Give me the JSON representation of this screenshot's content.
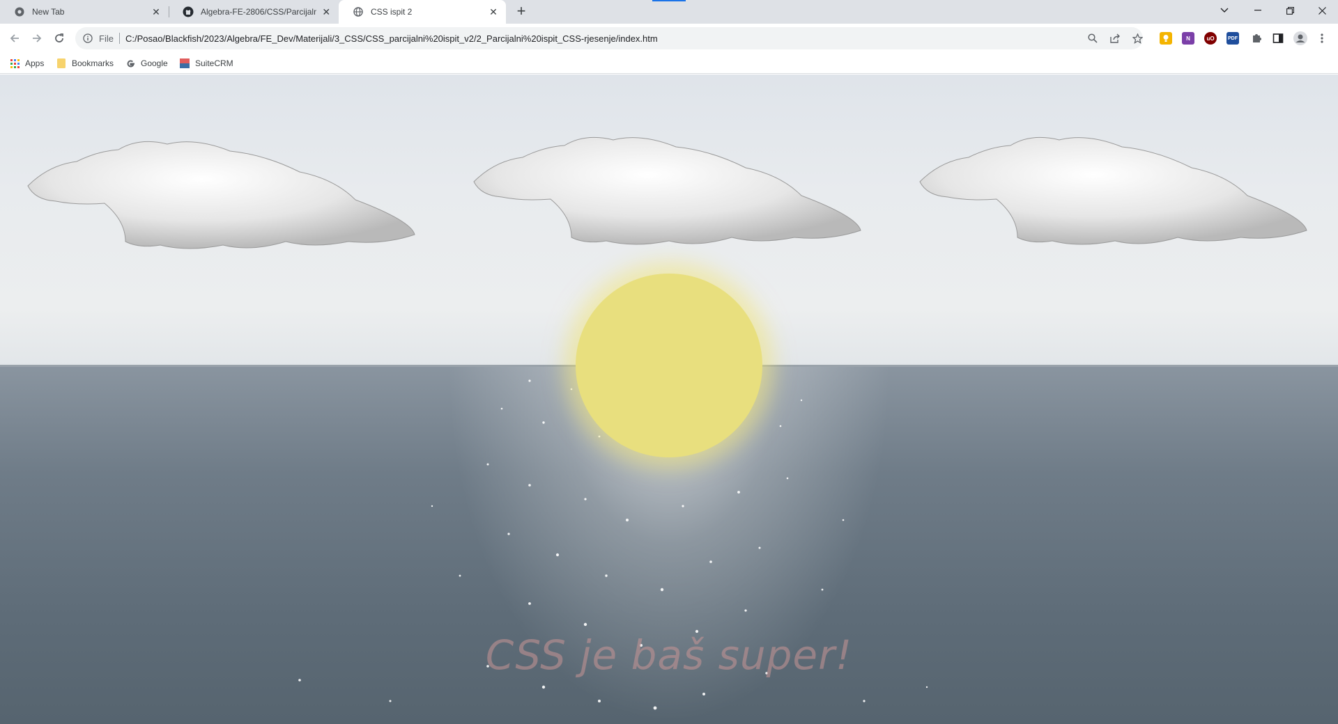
{
  "browser": {
    "tabs": [
      {
        "title": "New Tab",
        "icon": "chrome-icon",
        "active": false
      },
      {
        "title": "Algebra-FE-2806/CSS/Parcijalni",
        "icon": "github-icon",
        "active": false
      },
      {
        "title": "CSS ispit 2",
        "icon": "globe-icon",
        "active": true
      }
    ],
    "new_tab_symbol": "+",
    "close_symbol": "✕",
    "omnibox": {
      "scheme_label": "File",
      "url": "C:/Posao/Blackfish/2023/Algebra/FE_Dev/Materijali/3_CSS/CSS_parcijalni%20ispit_v2/2_Parcijalni%20ispit_CSS-rjesenje/index.htm"
    },
    "extensions": [
      {
        "name": "keep-icon",
        "color": "#f4b400",
        "label": ""
      },
      {
        "name": "onenote-icon",
        "color": "#7b3fa8",
        "label": "N"
      },
      {
        "name": "ublock-icon",
        "color": "#800000",
        "label": "uO"
      },
      {
        "name": "pdf-icon",
        "color": "#1f4e9c",
        "label": "PDF"
      }
    ],
    "bookmarks": [
      {
        "label": "Apps",
        "icon": "apps-grid-icon"
      },
      {
        "label": "Bookmarks",
        "icon": "folder-icon"
      },
      {
        "label": "Google",
        "icon": "google-icon"
      },
      {
        "label": "SuiteCRM",
        "icon": "suitecrm-icon"
      }
    ]
  },
  "page": {
    "slogan": "CSS je baš super!",
    "colors": {
      "sun": "#e8df7e",
      "slogan": "#c89696",
      "sea": "#5e6c78",
      "sky": "#e5e8eb"
    }
  }
}
